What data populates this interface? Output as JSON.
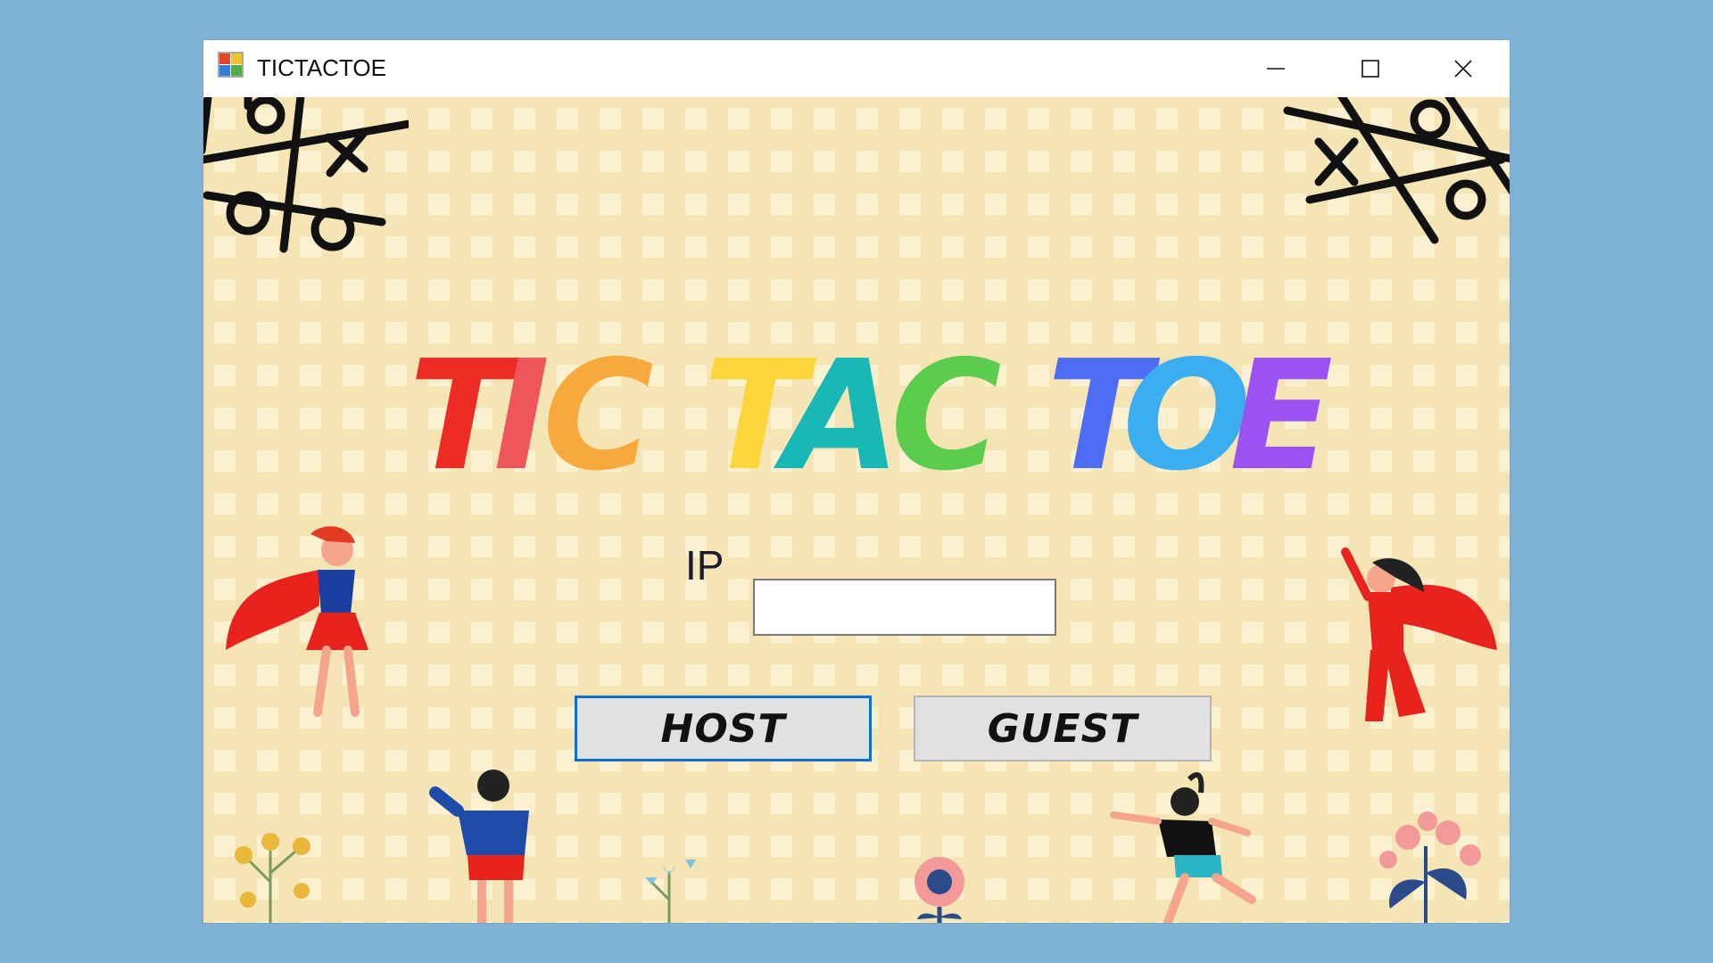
{
  "window": {
    "title": "TICTACTOE",
    "controls": {
      "minimize": "minimize-icon",
      "maximize": "maximize-icon",
      "close": "close-icon"
    }
  },
  "game": {
    "heading": "TIC TAC TOE",
    "heading_letters": [
      {
        "ch": "T",
        "color": "#ee2a24"
      },
      {
        "ch": "I",
        "color": "#f0555b"
      },
      {
        "ch": "C",
        "color": "#f7a93e"
      },
      {
        "ch": "T",
        "color": "#fbd53a"
      },
      {
        "ch": "A",
        "color": "#17b8b5"
      },
      {
        "ch": "C",
        "color": "#5ccc4e"
      },
      {
        "ch": "T",
        "color": "#4f6cf5"
      },
      {
        "ch": "O",
        "color": "#3aaef0"
      },
      {
        "ch": "E",
        "color": "#9a52f2"
      }
    ],
    "ip_label": "IP",
    "ip_value": "",
    "host_label": "HOST",
    "guest_label": "GUEST"
  },
  "colors": {
    "background": "#7fb2d4",
    "client_bg": "#f5e5b4",
    "focus_border": "#0a6fd1",
    "button_bg": "#e1e1e1"
  }
}
